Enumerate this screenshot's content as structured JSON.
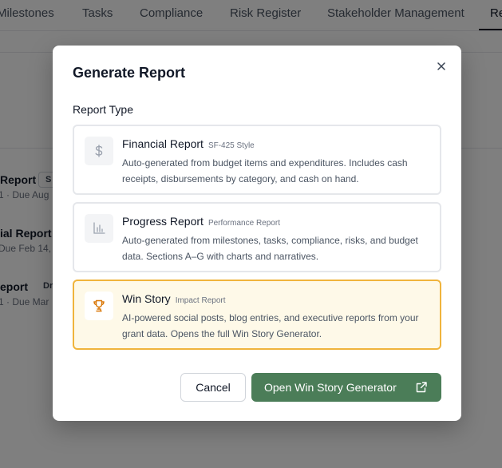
{
  "background": {
    "tabs": [
      "Milestones",
      "Tasks",
      "Compliance",
      "Risk Register",
      "Stakeholder Management",
      "Re"
    ],
    "reports": [
      {
        "title": "Report",
        "badge": "S",
        "due": "1 · Due Aug"
      },
      {
        "title": "ial Report",
        "badge": "",
        "due": "Due Feb 14,"
      },
      {
        "title": "eport",
        "badge": "Dr",
        "due": "1 · Due Mar"
      }
    ]
  },
  "modal": {
    "title": "Generate Report",
    "section_label": "Report Type",
    "close_icon": "close-icon",
    "options": [
      {
        "icon": "dollar-icon",
        "title": "Financial Report",
        "subtitle": "SF-425 Style",
        "description": "Auto-generated from budget items and expenditures. Includes cash receipts, disbursements by category, and cash on hand.",
        "selected": false
      },
      {
        "icon": "bar-chart-icon",
        "title": "Progress Report",
        "subtitle": "Performance Report",
        "description": "Auto-generated from milestones, tasks, compliance, risks, and budget data. Sections A–G with charts and narratives.",
        "selected": false
      },
      {
        "icon": "trophy-icon",
        "title": "Win Story",
        "subtitle": "Impact Report",
        "description": "AI-powered social posts, blog entries, and executive reports from your grant data. Opens the full Win Story Generator.",
        "selected": true
      }
    ],
    "cancel_label": "Cancel",
    "primary_label": "Open Win Story Generator",
    "primary_icon": "external-link-icon"
  },
  "colors": {
    "accent": "#4b7d58",
    "selected_border": "#f0b43c",
    "selected_bg": "#fef9e8",
    "trophy": "#d97706"
  }
}
